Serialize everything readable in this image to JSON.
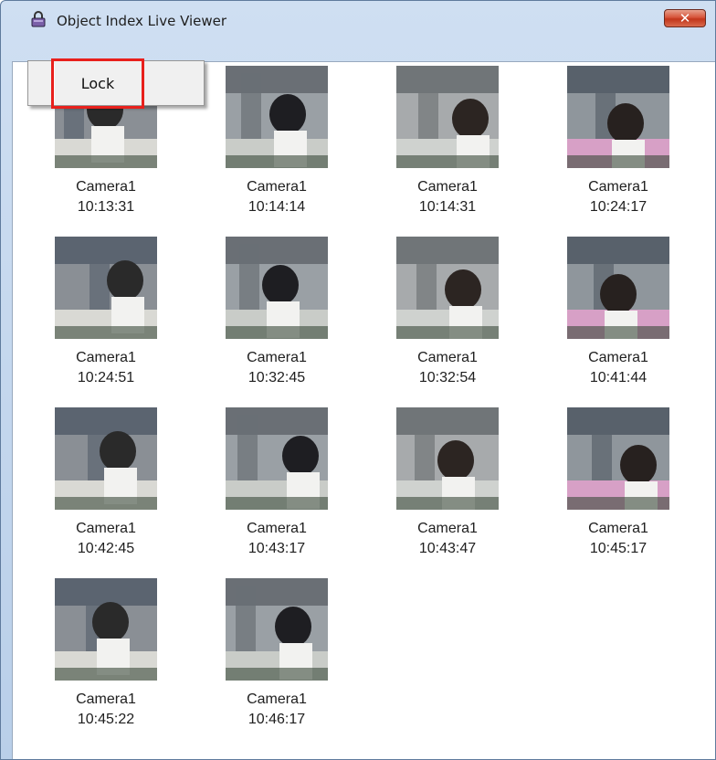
{
  "window": {
    "title": "Object Index Live Viewer",
    "close_glyph": "✕",
    "app_icon": "padlock-icon"
  },
  "context_menu": {
    "items": [
      {
        "label": "Lock"
      }
    ]
  },
  "thumbnails": [
    {
      "camera": "Camera1",
      "time": "10:13:31"
    },
    {
      "camera": "Camera1",
      "time": "10:14:14"
    },
    {
      "camera": "Camera1",
      "time": "10:14:31"
    },
    {
      "camera": "Camera1",
      "time": "10:24:17"
    },
    {
      "camera": "Camera1",
      "time": "10:24:51"
    },
    {
      "camera": "Camera1",
      "time": "10:32:45"
    },
    {
      "camera": "Camera1",
      "time": "10:32:54"
    },
    {
      "camera": "Camera1",
      "time": "10:41:44"
    },
    {
      "camera": "Camera1",
      "time": "10:42:45"
    },
    {
      "camera": "Camera1",
      "time": "10:43:17"
    },
    {
      "camera": "Camera1",
      "time": "10:43:47"
    },
    {
      "camera": "Camera1",
      "time": "10:45:17"
    },
    {
      "camera": "Camera1",
      "time": "10:45:22"
    },
    {
      "camera": "Camera1",
      "time": "10:46:17"
    }
  ]
}
